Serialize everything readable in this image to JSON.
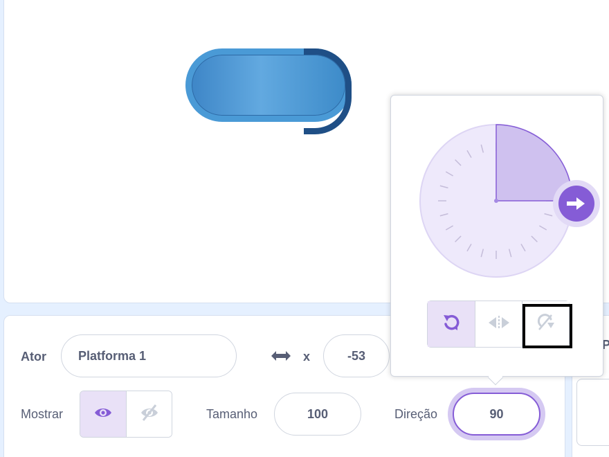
{
  "sprite_info": {
    "sprite_label": "Ator",
    "sprite_name": "Platforma 1",
    "x_label": "x",
    "x_value": "-53",
    "show_label": "Mostrar",
    "size_label": "Tamanho",
    "size_value": "100",
    "direction_label": "Direção",
    "direction_value": "90"
  },
  "direction_popover": {
    "direction_degrees": 90,
    "rotation_styles": [
      "all-around",
      "left-right",
      "dont-rotate"
    ],
    "selected_style": "all-around"
  },
  "right_panel": {
    "label": "P"
  },
  "colors": {
    "accent": "#855cd6",
    "accent_light": "#e9e1f7",
    "text": "#575e75"
  }
}
